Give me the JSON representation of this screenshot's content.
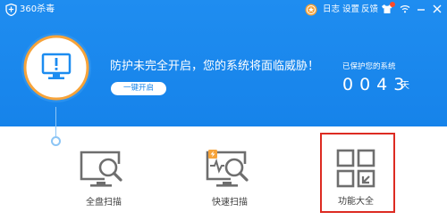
{
  "window": {
    "title": "360杀毒"
  },
  "toolbar": {
    "log_label": "日志",
    "settings_label": "设置",
    "feedback_label": "反馈"
  },
  "status": {
    "headline": "防护未完全开启，您的系统将面临威胁！",
    "enable_button_label": "一键开启",
    "protected_label": "已保护您的系统",
    "protected_days": "0043",
    "days_unit": "天"
  },
  "tools": [
    {
      "label": "全盘扫描",
      "icon": "monitor-magnifier-icon"
    },
    {
      "label": "快速扫描",
      "icon": "monitor-lightning-magnifier-icon"
    },
    {
      "label": "功能大全",
      "icon": "four-grid-icon"
    }
  ],
  "colors": {
    "header_blue": "#1683ea",
    "ring_orange": "#f6a33a",
    "highlight_red": "#dd2b22",
    "icon_gray": "#6e6e6e"
  }
}
